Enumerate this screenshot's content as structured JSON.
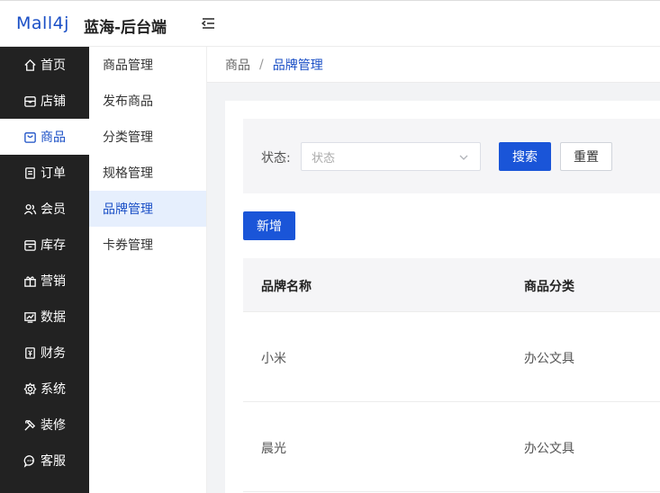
{
  "header": {
    "logo": "Mall4j",
    "shop_name": "蓝海-后台端"
  },
  "sidebar": {
    "items": [
      {
        "label": "首页",
        "icon": "home-icon"
      },
      {
        "label": "店铺",
        "icon": "shop-icon"
      },
      {
        "label": "商品",
        "icon": "product-icon",
        "active": true
      },
      {
        "label": "订单",
        "icon": "order-icon"
      },
      {
        "label": "会员",
        "icon": "member-icon"
      },
      {
        "label": "库存",
        "icon": "stock-icon"
      },
      {
        "label": "营销",
        "icon": "gift-icon"
      },
      {
        "label": "数据",
        "icon": "data-icon"
      },
      {
        "label": "财务",
        "icon": "finance-icon"
      },
      {
        "label": "系统",
        "icon": "settings-icon"
      },
      {
        "label": "装修",
        "icon": "decorate-icon"
      },
      {
        "label": "客服",
        "icon": "chat-icon"
      }
    ]
  },
  "submenu": {
    "items": [
      {
        "label": "商品管理"
      },
      {
        "label": "发布商品"
      },
      {
        "label": "分类管理"
      },
      {
        "label": "规格管理"
      },
      {
        "label": "品牌管理",
        "active": true
      },
      {
        "label": "卡券管理"
      }
    ]
  },
  "breadcrumb": {
    "root": "商品",
    "separator": "/",
    "current": "品牌管理"
  },
  "search": {
    "status_label": "状态:",
    "status_placeholder": "状态",
    "search_button": "搜索",
    "reset_button": "重置"
  },
  "actions": {
    "add_button": "新增"
  },
  "table": {
    "columns": [
      "品牌名称",
      "商品分类"
    ],
    "rows": [
      [
        "小米",
        "办公文具"
      ],
      [
        "晨光",
        "办公文具"
      ]
    ]
  },
  "colors": {
    "accent": "#1a55d8",
    "sidebar_bg": "#222222",
    "active_bg": "#e6effd"
  }
}
